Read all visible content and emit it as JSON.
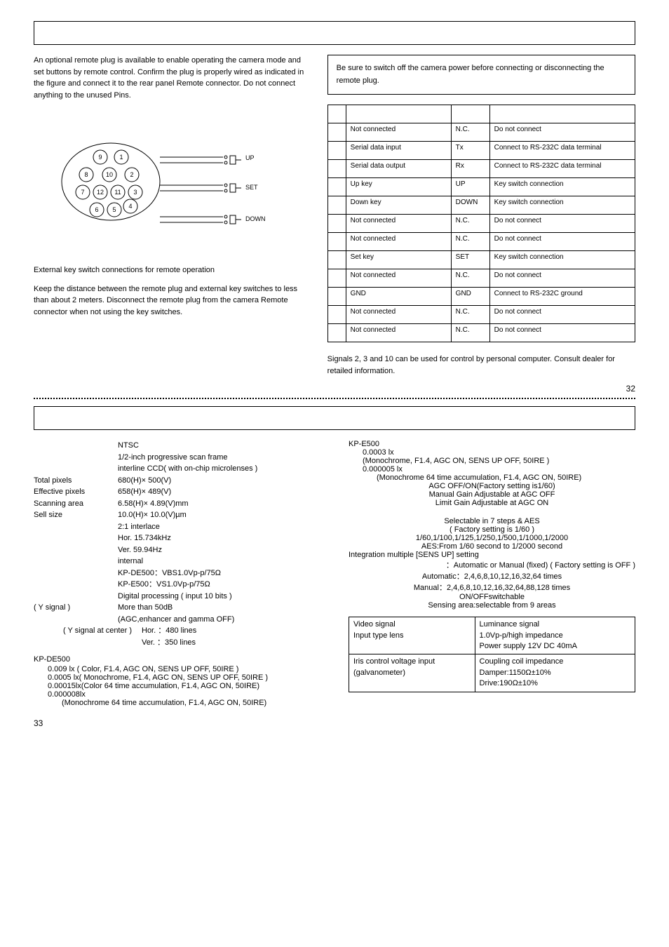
{
  "remote": {
    "intro": "An optional remote plug is available to enable operating the camera mode and set buttons by remote control. Confirm the plug is properly wired as indicated in the figure and connect it to the rear panel Remote connector. Do not connect anything to the unused Pins.",
    "notice": "Be sure to switch off the camera power before connecting or disconnecting the remote plug.",
    "switch_labels": {
      "up": "UP",
      "set": "SET",
      "down": "DOWN"
    },
    "pin_header": {
      "c1": "",
      "c2": "",
      "c3": "",
      "c4": ""
    },
    "pins": [
      {
        "no": "",
        "func": "Not connected",
        "sym": "N.C.",
        "rem": "Do not connect"
      },
      {
        "no": "",
        "func": "Serial data input",
        "sym": "Tx",
        "rem": "Connect to RS-232C data terminal"
      },
      {
        "no": "",
        "func": "Serial data output",
        "sym": "Rx",
        "rem": "Connect to RS-232C data terminal"
      },
      {
        "no": "",
        "func": "Up key",
        "sym": "UP",
        "rem": "Key switch connection"
      },
      {
        "no": "",
        "func": "Down key",
        "sym": "DOWN",
        "rem": "Key switch connection"
      },
      {
        "no": "",
        "func": "Not connected",
        "sym": "N.C.",
        "rem": "Do not connect"
      },
      {
        "no": "",
        "func": "Not connected",
        "sym": "N.C.",
        "rem": "Do not connect"
      },
      {
        "no": "",
        "func": "Set key",
        "sym": "SET",
        "rem": "Key switch connection"
      },
      {
        "no": "",
        "func": "Not connected",
        "sym": "N.C.",
        "rem": "Do not connect"
      },
      {
        "no": "",
        "func": "GND",
        "sym": "GND",
        "rem": "Connect to RS-232C ground"
      },
      {
        "no": "",
        "func": "Not connected",
        "sym": "N.C.",
        "rem": "Do not connect"
      },
      {
        "no": "",
        "func": "Not connected",
        "sym": "N.C.",
        "rem": "Do not connect"
      }
    ],
    "ext_title": "External key switch connections for remote operation",
    "ext_para": "Keep the distance between the remote plug and external key switches to less than about 2 meters. Disconnect the remote plug from the camera Remote connector when not using the key switches.",
    "signals_note": "Signals 2, 3 and 10 can be used for control by personal computer. Consult dealer for retailed information.",
    "page": "32"
  },
  "specs": {
    "left": {
      "ntsc": "NTSC",
      "ccd1": "1/2-inch progressive scan frame",
      "ccd2": "interline CCD( with on-chip microlenses )",
      "tp_l": "Total pixels",
      "tp_v": "680(H)× 500(V)",
      "ep_l": "Effective pixels",
      "ep_v": "658(H)× 489(V)",
      "sa_l": "Scanning area",
      "sa_v": "6.58(H)× 4.89(V)mm",
      "ss_l": "Sell size",
      "ss_v": "10.0(H)× 10.0(V)µm",
      "inter": "2:1 interlace",
      "hor": "Hor.    15.734kHz",
      "ver": "Ver.    59.94Hz",
      "sync": "internal",
      "out1": "KP-DE500：VBS1.0Vp-p/75Ω",
      "out2": "KP-E500：VS1.0Vp-p/75Ω",
      "dig": "Digital processing ( input 10 bits )",
      "sn_l": "( Y signal )",
      "sn_v": "More than 50dB",
      "sn2": "(AGC,enhancer and gamma OFF)",
      "res_l": "( Y signal at center )",
      "res_h": "Hor.   ：480 lines",
      "res_v": "Ver.   ：350 lines",
      "min_head": "KP-DE500",
      "min1": "0.009 lx ( Color, F1.4, AGC ON, SENS UP OFF, 50IRE )",
      "min2": "0.0005 lx( Monochrome, F1.4, AGC ON, SENS UP OFF, 50IRE )",
      "min3": "0.00015lx(Color 64 time accumulation, F1.4, AGC ON, 50IRE)",
      "min4": "0.000008lx",
      "min5": "(Monochrome 64 time accumulation, F1.4, AGC ON, 50IRE)"
    },
    "right": {
      "kpe": "KP-E500",
      "r1": "0.0003 lx",
      "r1b": "(Monochrome, F1.4, AGC ON, SENS UP OFF, 50IRE )",
      "r2": "0.000005 lx",
      "r2b": "(Monochrome 64 time accumulation, F1.4, AGC ON, 50IRE)",
      "agc1": "AGC OFF/ON(Factory setting is1/60)",
      "agc2": "Manual Gain Adjustable at AGC OFF",
      "agc3": "Limit Gain Adjustable at AGC ON",
      "sh1": "Selectable in 7 steps & AES",
      "sh2": "( Factory setting is 1/60 )",
      "sh3": "1/60,1/100,1/125,1/250,1/500,1/1000,1/2000",
      "sh4": "AES:From 1/60 second to 1/2000 second",
      "su_h": "Integration multiple [SENS UP] setting",
      "su1": "：Automatic or Manual (fixed) ( Factory setting is OFF )",
      "su2": "Automatic：2,4,6,8,10,12,16,32,64 times",
      "su3": "Manual：2,4,6,8,10,12,16,32,64,88,128 times",
      "blc1": "ON/OFFswitchable",
      "blc2": "Sensing area:selectable from 9 areas",
      "lens": {
        "r1c1a": "Video signal",
        "r1c1b": "Input type lens",
        "r1c2a": "Luminance signal",
        "r1c2b": "1.0Vp-p/high impedance",
        "r1c2c": "Power supply 12V DC    40mA",
        "r2c1a": "Iris control voltage input",
        "r2c1b": "(galvanometer)",
        "r2c2a": "Coupling coil impedance",
        "r2c2b": "Damper:1150Ω±10%",
        "r2c2c": "Drive:190Ω±10%"
      }
    },
    "page": "33"
  }
}
